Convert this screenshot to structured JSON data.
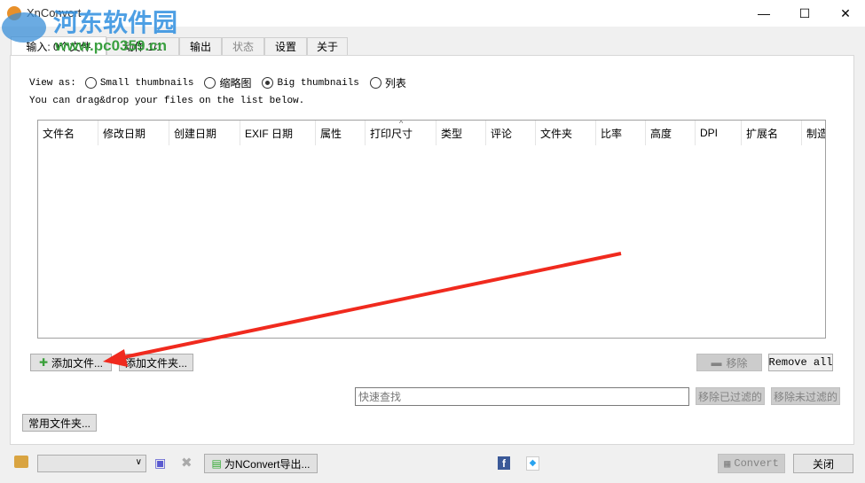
{
  "window": {
    "title": "XnConvert",
    "minimize": "—",
    "maximize": "☐",
    "close": "✕"
  },
  "watermark": {
    "name": "河东软件园",
    "url": "www.pc0359.cn"
  },
  "tabs": [
    {
      "label": "输入: 0个文件"
    },
    {
      "label": "动作 1/1"
    },
    {
      "label": "输出"
    },
    {
      "label": "状态"
    },
    {
      "label": "设置"
    },
    {
      "label": "关于"
    }
  ],
  "view": {
    "label": "View as:",
    "options": [
      "Small thumbnails",
      "缩略图",
      "Big thumbnails",
      "列表"
    ],
    "selected": 2,
    "hint": "You can drag&drop your files on the list below."
  },
  "columns": [
    "文件名",
    "修改日期",
    "创建日期",
    "EXIF 日期",
    "属性",
    "打印尺寸",
    "类型",
    "评论",
    "文件夹",
    "比率",
    "高度",
    "DPI",
    "扩展名",
    "制造"
  ],
  "buttons": {
    "add_files": "添加文件...",
    "add_folder": "添加文件夹...",
    "remove": "移除",
    "remove_all": "Remove all",
    "remove_filtered": "移除已过滤的",
    "remove_unfiltered": "移除未过滤的",
    "favorites": "常用文件夹...",
    "export": "为NConvert导出...",
    "convert": "Convert",
    "close": "关闭"
  },
  "search": {
    "placeholder": "快速查找"
  },
  "colors": {
    "arrow": "#f02a1e",
    "accent": "#1e90ff"
  }
}
